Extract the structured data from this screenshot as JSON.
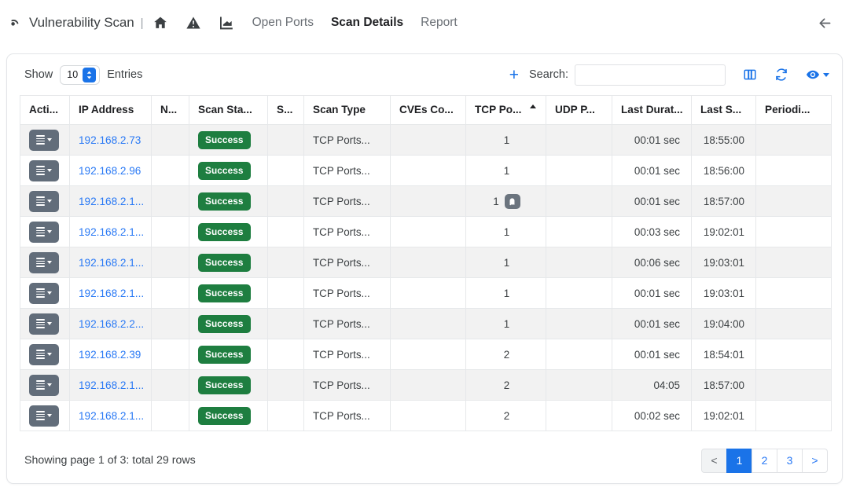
{
  "header": {
    "brand": "Vulnerability Scan",
    "separator": "|",
    "icons": [
      "home-icon",
      "warning-triangle-icon",
      "chart-icon"
    ],
    "links": [
      {
        "label": "Open Ports",
        "active": false
      },
      {
        "label": "Scan Details",
        "active": true
      },
      {
        "label": "Report",
        "active": false
      }
    ],
    "back_icon": "back-arrow-icon"
  },
  "toolbar": {
    "show_label": "Show",
    "entries_value": "10",
    "entries_label": "Entries",
    "add_label": "+",
    "search_label": "Search:",
    "search_value": "",
    "search_placeholder": "",
    "columns_icon": "columns-icon",
    "refresh_icon": "refresh-icon",
    "visibility_icon": "eye-icon"
  },
  "table": {
    "columns": [
      {
        "key": "actions",
        "label": "Acti...",
        "sorted": null
      },
      {
        "key": "ip",
        "label": "IP Address",
        "sorted": null
      },
      {
        "key": "n",
        "label": "N...",
        "sorted": null
      },
      {
        "key": "scanstatus",
        "label": "Scan Sta...",
        "sorted": null
      },
      {
        "key": "s",
        "label": "S...",
        "sorted": null
      },
      {
        "key": "scantype",
        "label": "Scan Type",
        "sorted": null
      },
      {
        "key": "cves",
        "label": "CVEs Co...",
        "sorted": null
      },
      {
        "key": "tcp",
        "label": "TCP Po...",
        "sorted": "asc"
      },
      {
        "key": "udp",
        "label": "UDP P...",
        "sorted": null
      },
      {
        "key": "duration",
        "label": "Last Durat...",
        "sorted": null
      },
      {
        "key": "lastscan",
        "label": "Last S...",
        "sorted": null
      },
      {
        "key": "periodic",
        "label": "Periodi...",
        "sorted": null
      }
    ],
    "rows": [
      {
        "ip": "192.168.2.73",
        "n": "",
        "scanstatus": "Success",
        "s": "",
        "scantype": "TCP Ports...",
        "cves": "",
        "tcp": "1",
        "tcp_badge": false,
        "udp": "",
        "duration": "00:01 sec",
        "lastscan": "18:55:00",
        "periodic": ""
      },
      {
        "ip": "192.168.2.96",
        "n": "",
        "scanstatus": "Success",
        "s": "",
        "scantype": "TCP Ports...",
        "cves": "",
        "tcp": "1",
        "tcp_badge": false,
        "udp": "",
        "duration": "00:01 sec",
        "lastscan": "18:56:00",
        "periodic": ""
      },
      {
        "ip": "192.168.2.1...",
        "n": "",
        "scanstatus": "Success",
        "s": "",
        "scantype": "TCP Ports...",
        "cves": "",
        "tcp": "1",
        "tcp_badge": true,
        "udp": "",
        "duration": "00:01 sec",
        "lastscan": "18:57:00",
        "periodic": ""
      },
      {
        "ip": "192.168.2.1...",
        "n": "",
        "scanstatus": "Success",
        "s": "",
        "scantype": "TCP Ports...",
        "cves": "",
        "tcp": "1",
        "tcp_badge": false,
        "udp": "",
        "duration": "00:03 sec",
        "lastscan": "19:02:01",
        "periodic": ""
      },
      {
        "ip": "192.168.2.1...",
        "n": "",
        "scanstatus": "Success",
        "s": "",
        "scantype": "TCP Ports...",
        "cves": "",
        "tcp": "1",
        "tcp_badge": false,
        "udp": "",
        "duration": "00:06 sec",
        "lastscan": "19:03:01",
        "periodic": ""
      },
      {
        "ip": "192.168.2.1...",
        "n": "",
        "scanstatus": "Success",
        "s": "",
        "scantype": "TCP Ports...",
        "cves": "",
        "tcp": "1",
        "tcp_badge": false,
        "udp": "",
        "duration": "00:01 sec",
        "lastscan": "19:03:01",
        "periodic": ""
      },
      {
        "ip": "192.168.2.2...",
        "n": "",
        "scanstatus": "Success",
        "s": "",
        "scantype": "TCP Ports...",
        "cves": "",
        "tcp": "1",
        "tcp_badge": false,
        "udp": "",
        "duration": "00:01 sec",
        "lastscan": "19:04:00",
        "periodic": ""
      },
      {
        "ip": "192.168.2.39",
        "n": "",
        "scanstatus": "Success",
        "s": "",
        "scantype": "TCP Ports...",
        "cves": "",
        "tcp": "2",
        "tcp_badge": false,
        "udp": "",
        "duration": "00:01 sec",
        "lastscan": "18:54:01",
        "periodic": ""
      },
      {
        "ip": "192.168.2.1...",
        "n": "",
        "scanstatus": "Success",
        "s": "",
        "scantype": "TCP Ports...",
        "cves": "",
        "tcp": "2",
        "tcp_badge": false,
        "udp": "",
        "duration": "04:05",
        "lastscan": "18:57:00",
        "periodic": ""
      },
      {
        "ip": "192.168.2.1...",
        "n": "",
        "scanstatus": "Success",
        "s": "",
        "scantype": "TCP Ports...",
        "cves": "",
        "tcp": "2",
        "tcp_badge": false,
        "udp": "",
        "duration": "00:02 sec",
        "lastscan": "19:02:01",
        "periodic": ""
      }
    ]
  },
  "footer": {
    "summary": "Showing page 1 of 3: total 29 rows",
    "pager": [
      {
        "label": "<",
        "state": "prev"
      },
      {
        "label": "1",
        "state": "active"
      },
      {
        "label": "2",
        "state": "normal"
      },
      {
        "label": "3",
        "state": "normal"
      },
      {
        "label": ">",
        "state": "normal"
      }
    ]
  },
  "colors": {
    "accent": "#1a73e8",
    "link": "#2979f5",
    "success": "#1e7e40",
    "action_button": "#626d7a",
    "row_stripe": "#f2f2f2"
  }
}
